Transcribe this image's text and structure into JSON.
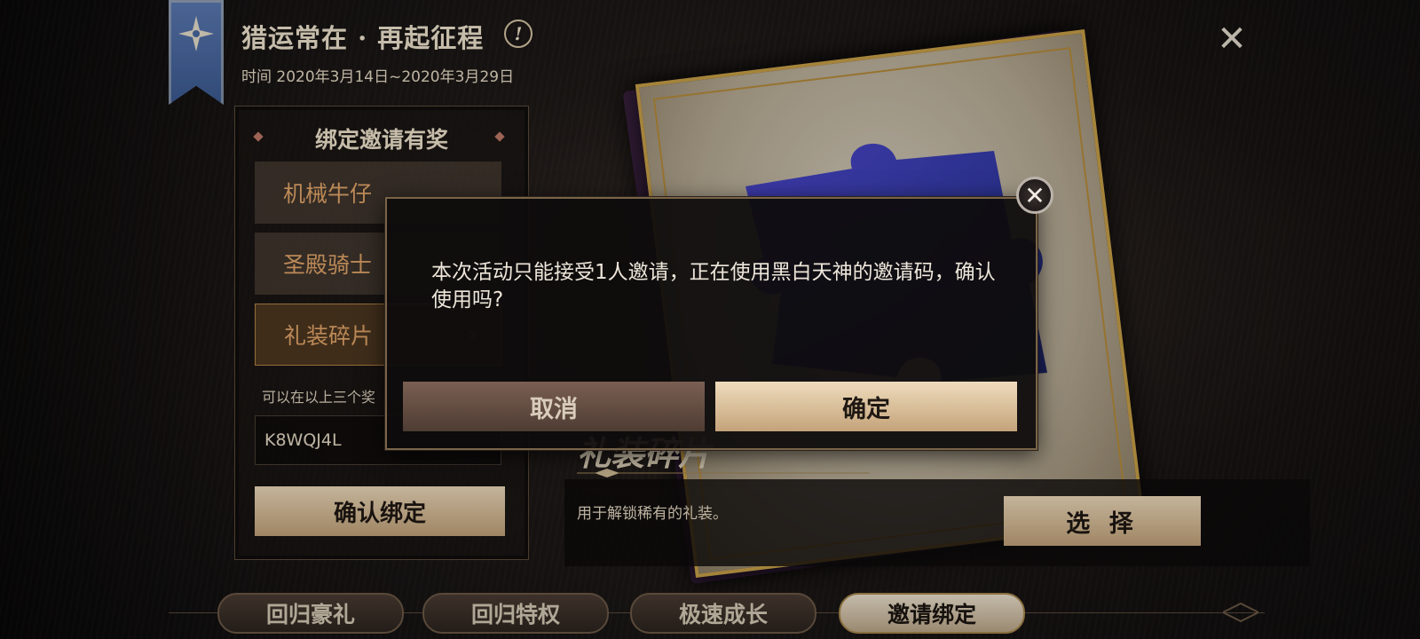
{
  "event": {
    "title": "猎运常在 · 再起征程",
    "info_icon": "!",
    "date": "时间 2020年3月14日~2020年3月29日",
    "close_icon": "✕"
  },
  "left_panel": {
    "title": "绑定邀请有奖",
    "options": [
      {
        "label": "机械牛仔",
        "selected": false
      },
      {
        "label": "圣殿骑士",
        "selected": false
      },
      {
        "label": "礼装碎片",
        "selected": true
      }
    ],
    "hint": "可以在以上三个奖",
    "code_value": "K8WQJ4L",
    "bind_button": "确认绑定"
  },
  "card": {
    "name": "礼装碎片",
    "description": "用于解锁稀有的礼装。",
    "select_button": "选 择"
  },
  "tabs": [
    {
      "label": "回归豪礼",
      "active": false
    },
    {
      "label": "回归特权",
      "active": false
    },
    {
      "label": "极速成长",
      "active": false
    },
    {
      "label": "邀请绑定",
      "active": true
    }
  ],
  "dialog": {
    "message": "本次活动只能接受1人邀请，正在使用黑白天神的邀请码，确认使用吗?",
    "cancel": "取消",
    "confirm": "确定",
    "close_icon": "✕"
  },
  "colors": {
    "accent_gold": "#c4a37a",
    "option_text": "#e6a86b",
    "banner_blue": "#4a6aa4"
  }
}
